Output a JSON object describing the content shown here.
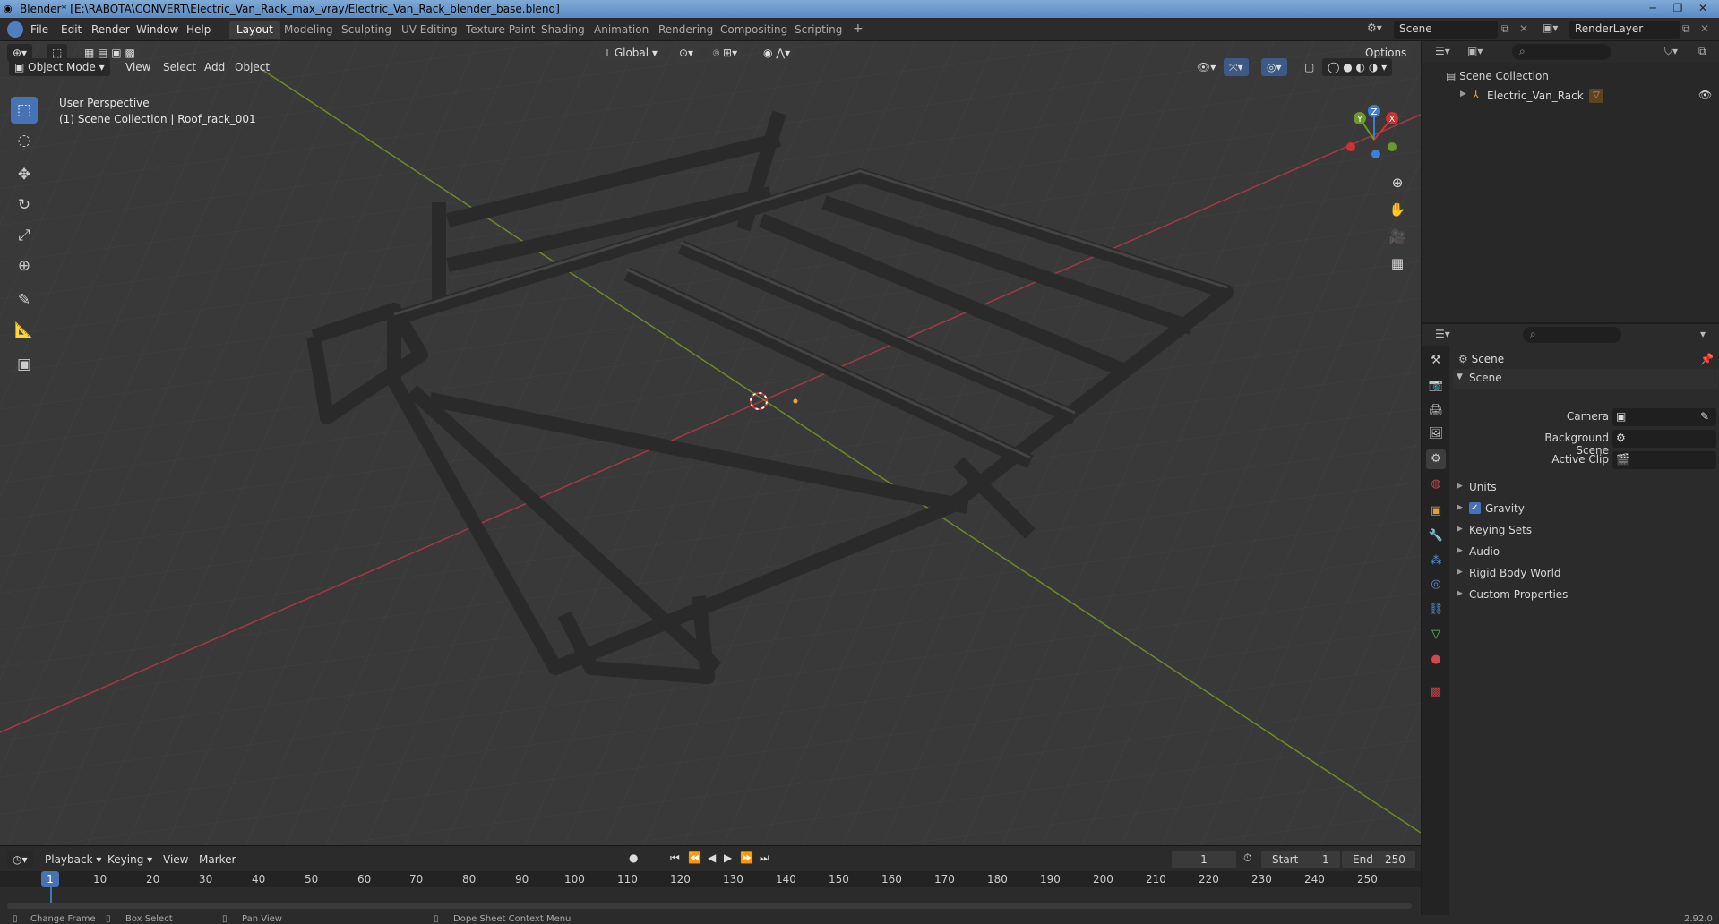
{
  "window": {
    "title": "Blender* [E:\\RABOTA\\CONVERT\\Electric_Van_Rack_max_vray/Electric_Van_Rack_blender_base.blend]"
  },
  "menu": {
    "items": [
      "File",
      "Edit",
      "Render",
      "Window",
      "Help"
    ],
    "workspaces": [
      "Layout",
      "Modeling",
      "Sculpting",
      "UV Editing",
      "Texture Paint",
      "Shading",
      "Animation",
      "Rendering",
      "Compositing",
      "Scripting"
    ],
    "active_workspace": "Layout",
    "add_tab": "+",
    "scene_name": "Scene",
    "render_layer": "RenderLayer"
  },
  "viewport": {
    "mode": "Object Mode",
    "menus": [
      "View",
      "Select",
      "Add",
      "Object"
    ],
    "transform_orientation": "Global",
    "options_label": "Options",
    "overlay_title": "User Perspective",
    "overlay_subtitle": "(1) Scene Collection | Roof_rack_001",
    "gizmo": {
      "x": "X",
      "y": "Y",
      "z": "Z"
    }
  },
  "outliner": {
    "root": "Scene Collection",
    "items": [
      {
        "label": "Electric_Van_Rack"
      }
    ]
  },
  "properties": {
    "header": "Scene",
    "section": "Scene",
    "fields": [
      {
        "label": "Camera",
        "value": ""
      },
      {
        "label": "Background Scene",
        "value": ""
      },
      {
        "label": "Active Clip",
        "value": ""
      }
    ],
    "panels": [
      {
        "label": "Units",
        "checkbox": false
      },
      {
        "label": "Gravity",
        "checkbox": true
      },
      {
        "label": "Keying Sets",
        "checkbox": false
      },
      {
        "label": "Audio",
        "checkbox": false
      },
      {
        "label": "Rigid Body World",
        "checkbox": false
      },
      {
        "label": "Custom Properties",
        "checkbox": false
      }
    ]
  },
  "timeline": {
    "menus": [
      "Playback",
      "Keying",
      "View",
      "Marker"
    ],
    "current_frame": "1",
    "start_label": "Start",
    "start": "1",
    "end_label": "End",
    "end": "250",
    "ticks": [
      "1",
      "10",
      "20",
      "30",
      "40",
      "50",
      "60",
      "70",
      "80",
      "90",
      "100",
      "110",
      "120",
      "130",
      "140",
      "150",
      "160",
      "170",
      "180",
      "190",
      "200",
      "210",
      "220",
      "230",
      "240",
      "250"
    ]
  },
  "statusbar": {
    "items": [
      "Change Frame",
      "Box Select",
      "Pan View",
      "Dope Sheet Context Menu"
    ],
    "version": "2.92.0"
  }
}
